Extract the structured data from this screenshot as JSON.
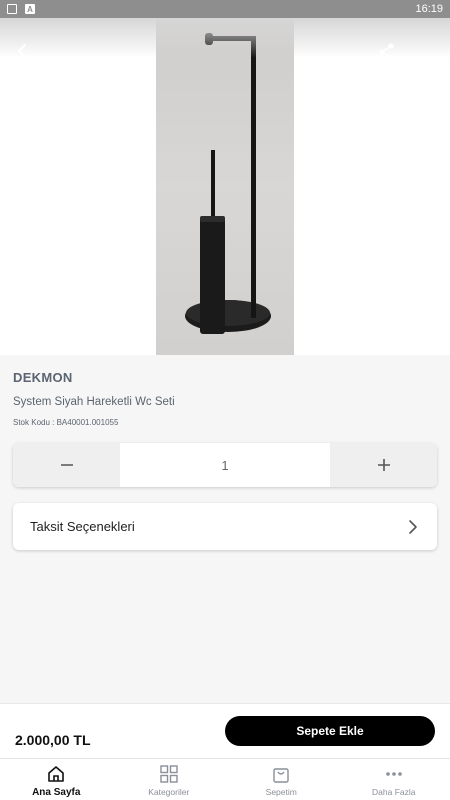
{
  "statusbar": {
    "time": "16:19",
    "icons": [
      "image-icon",
      "a-icon"
    ]
  },
  "header": {
    "back_icon": "chevron-left-icon",
    "share_icon": "share-icon"
  },
  "product": {
    "brand": "DEKMON",
    "name": "System Siyah Hareketli Wc Seti",
    "sku_text": "Stok Kodu : BA40001.001055",
    "image_alt": "black-toilet-paper-holder-with-brush"
  },
  "quantity": {
    "value": "1",
    "minus_icon": "minus-icon",
    "plus_icon": "plus-icon"
  },
  "installments": {
    "label": "Taksit Seçenekleri",
    "chevron_icon": "chevron-right-icon"
  },
  "buybar": {
    "price": "2.000,00 TL",
    "cart_button": "Sepete Ekle"
  },
  "tabs": [
    {
      "label": "Ana Sayfa",
      "icon": "home-icon",
      "active": true
    },
    {
      "label": "Kategoriler",
      "icon": "grid-icon",
      "active": false
    },
    {
      "label": "Sepetim",
      "icon": "bag-icon",
      "active": false
    },
    {
      "label": "Daha Fazla",
      "icon": "more-icon",
      "active": false
    }
  ],
  "colors": {
    "primary": "#000000",
    "text_muted": "#5b6470",
    "background": "#f6f6f6"
  }
}
